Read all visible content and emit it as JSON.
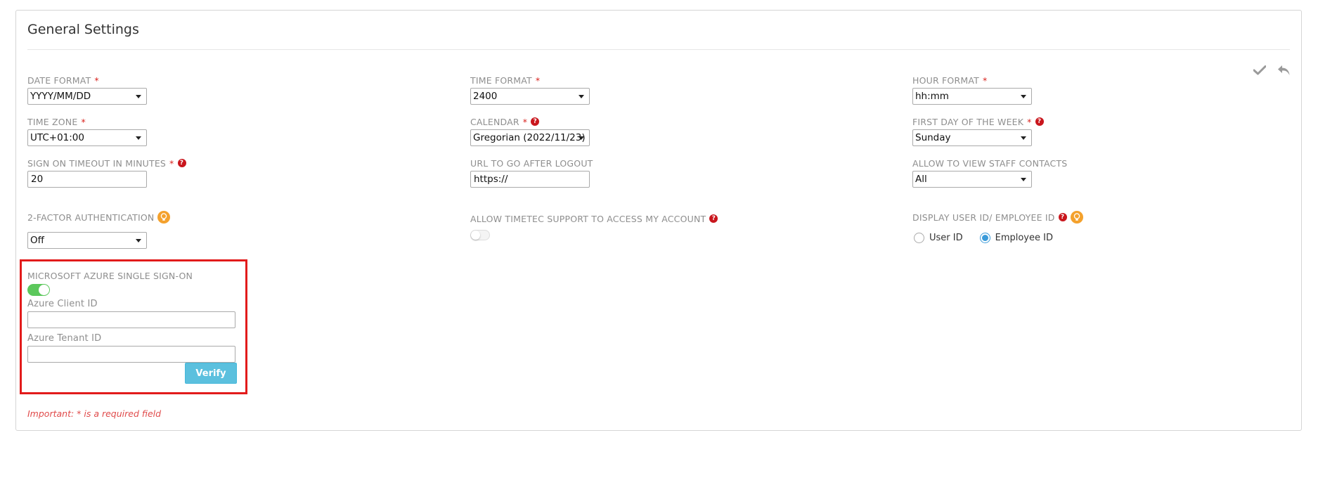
{
  "panel": {
    "title": "General Settings"
  },
  "toolbar": {
    "save_icon": "check-icon",
    "undo_icon": "undo-icon"
  },
  "fields": {
    "date_format": {
      "label": "DATE FORMAT",
      "value": "YYYY/MM/DD"
    },
    "time_format": {
      "label": "TIME FORMAT",
      "value": "2400"
    },
    "hour_format": {
      "label": "HOUR FORMAT",
      "value": "hh:mm"
    },
    "time_zone": {
      "label": "TIME ZONE",
      "value": "UTC+01:00"
    },
    "calendar": {
      "label": "CALENDAR",
      "value": "Gregorian (2022/11/23)"
    },
    "first_day": {
      "label": "FIRST DAY OF THE WEEK",
      "value": "Sunday"
    },
    "sign_on_timeout": {
      "label": "SIGN ON TIMEOUT IN MINUTES",
      "value": "20"
    },
    "logout_url": {
      "label": "URL TO GO AFTER LOGOUT",
      "value": "https://"
    },
    "staff_contacts": {
      "label": "ALLOW TO VIEW STAFF CONTACTS",
      "value": "All"
    },
    "two_factor": {
      "label": "2-FACTOR AUTHENTICATION",
      "value": "Off"
    },
    "support_access": {
      "label": "ALLOW TIMETEC SUPPORT TO ACCESS MY ACCOUNT"
    },
    "display_id": {
      "label": "DISPLAY USER ID/ EMPLOYEE ID",
      "options": [
        "User ID",
        "Employee ID"
      ],
      "selected": "Employee ID"
    }
  },
  "required_mark": "*",
  "help_mark": "?",
  "sso": {
    "label": "MICROSOFT AZURE SINGLE SIGN-ON",
    "client_id_label": "Azure Client ID",
    "client_id_value": "",
    "tenant_id_label": "Azure Tenant ID",
    "tenant_id_value": "",
    "verify_label": "Verify"
  },
  "footer": {
    "important": "Important: * is a required field"
  },
  "colors": {
    "required": "#d9231e",
    "toggle_on": "#5cc85c",
    "verify": "#5bc0de",
    "highlight_border": "#e21b1b"
  }
}
